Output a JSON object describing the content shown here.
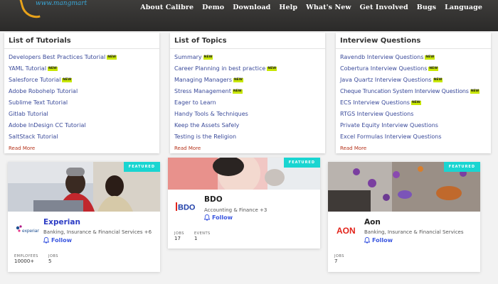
{
  "header": {
    "logo_text": "www.mangmart",
    "nav": [
      "About Calibre",
      "Demo",
      "Download",
      "Help",
      "What's New",
      "Get Involved",
      "Bugs",
      "Language"
    ]
  },
  "panels": [
    {
      "title": "List of Tutorials",
      "items": [
        {
          "label": "Developers Best Practices Tutorial",
          "is_new": true
        },
        {
          "label": "YAML Tutorial",
          "is_new": true
        },
        {
          "label": "Salesforce Tutorial",
          "is_new": true
        },
        {
          "label": "Adobe Robohelp Tutorial",
          "is_new": false
        },
        {
          "label": "Sublime Text Tutorial",
          "is_new": false
        },
        {
          "label": "Gitlab Tutorial",
          "is_new": false
        },
        {
          "label": "Adobe InDesign CC Tutorial",
          "is_new": false
        },
        {
          "label": "SaltStack Tutorial",
          "is_new": false
        }
      ],
      "read_more": "Read More"
    },
    {
      "title": "List of Topics",
      "items": [
        {
          "label": "Summary",
          "is_new": true
        },
        {
          "label": "Career Planning in best practice",
          "is_new": true
        },
        {
          "label": "Managing Managers",
          "is_new": true
        },
        {
          "label": "Stress Management",
          "is_new": true
        },
        {
          "label": "Eager to Learn",
          "is_new": false
        },
        {
          "label": "Handy Tools & Techniques",
          "is_new": false
        },
        {
          "label": "Keep the Assets Safely",
          "is_new": false
        },
        {
          "label": "Testing is the Religion",
          "is_new": false
        }
      ],
      "read_more": "Read More"
    },
    {
      "title": "Interview Questions",
      "items": [
        {
          "label": "Ravendb Interview Questions",
          "is_new": true
        },
        {
          "label": "Cobertura Interview Questions",
          "is_new": true
        },
        {
          "label": "Java Quartz Interview Questions",
          "is_new": true
        },
        {
          "label": "Cheque Truncation System Interview Questions",
          "is_new": true
        },
        {
          "label": "ECS Interview Questions",
          "is_new": true
        },
        {
          "label": "RTGS Interview Questions",
          "is_new": false
        },
        {
          "label": "Private Equity Interview Questions",
          "is_new": false
        },
        {
          "label": "Excel Formulas Interview Questions",
          "is_new": false
        }
      ],
      "read_more": "Read More"
    }
  ],
  "new_badge": "NEW",
  "cards": {
    "featured_label": "FEATURED",
    "follow_label": "Follow",
    "experian": {
      "name": "Experian",
      "logo_text": "experian",
      "industry": "Banking, Insurance & Financial Services",
      "industry_extra": "+6",
      "stat1_label": "EMPLOYEES",
      "stat1_value": "10000+",
      "stat2_label": "JOBS",
      "stat2_value": "5"
    },
    "bdo": {
      "name": "BDO",
      "logo_text": "BDO",
      "industry": "Accounting & Finance",
      "industry_extra": "+3",
      "stat1_label": "JOBS",
      "stat1_value": "17",
      "stat2_label": "EVENTS",
      "stat2_value": "1"
    },
    "aon": {
      "name": "Aon",
      "logo_text": "AON",
      "industry": "Banking, Insurance & Financial Services",
      "stat1_label": "JOBS",
      "stat1_value": "7"
    }
  },
  "colors": {
    "header_bg": "#2e2d2b",
    "link": "#3a4a9a",
    "read_more": "#b5321a",
    "featured": "#19d5d1",
    "follow": "#3a56e0",
    "new_badge": "#c7e600",
    "aon_red": "#e2231a",
    "bdo_blue": "#1f3fa8"
  }
}
